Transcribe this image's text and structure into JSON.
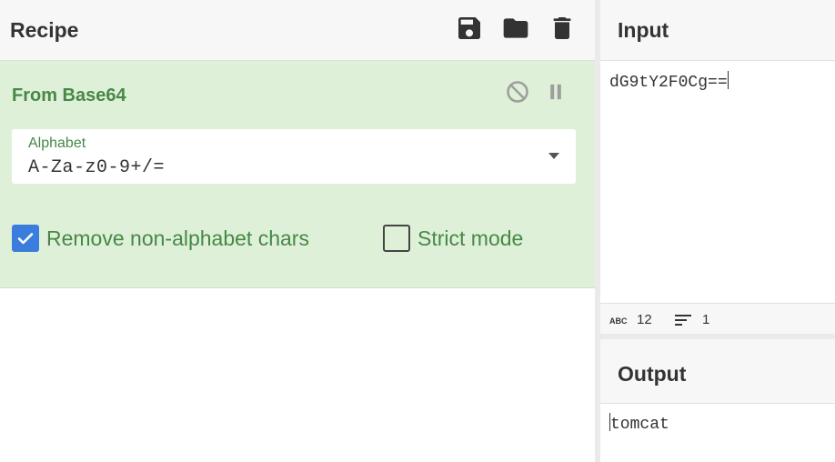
{
  "recipe": {
    "title": "Recipe",
    "header_icons": [
      "save-icon",
      "folder-icon",
      "trash-icon"
    ],
    "operation": {
      "name": "From Base64",
      "controls": [
        "disable-icon",
        "pause-icon"
      ],
      "alphabet": {
        "label": "Alphabet",
        "value": "A-Za-z0-9+/="
      },
      "options": [
        {
          "label": "Remove non-alphabet chars",
          "checked": true
        },
        {
          "label": "Strict mode",
          "checked": false
        }
      ]
    }
  },
  "input": {
    "title": "Input",
    "value": "dG9tY2F0Cg==",
    "status": {
      "length": "12",
      "lines": "1"
    }
  },
  "output": {
    "title": "Output",
    "value": "tomcat"
  },
  "colors": {
    "op_background": "#dff0d8",
    "op_text": "#468847",
    "checkbox_accent": "#3b7ddd",
    "header_background": "#f7f7f7"
  }
}
